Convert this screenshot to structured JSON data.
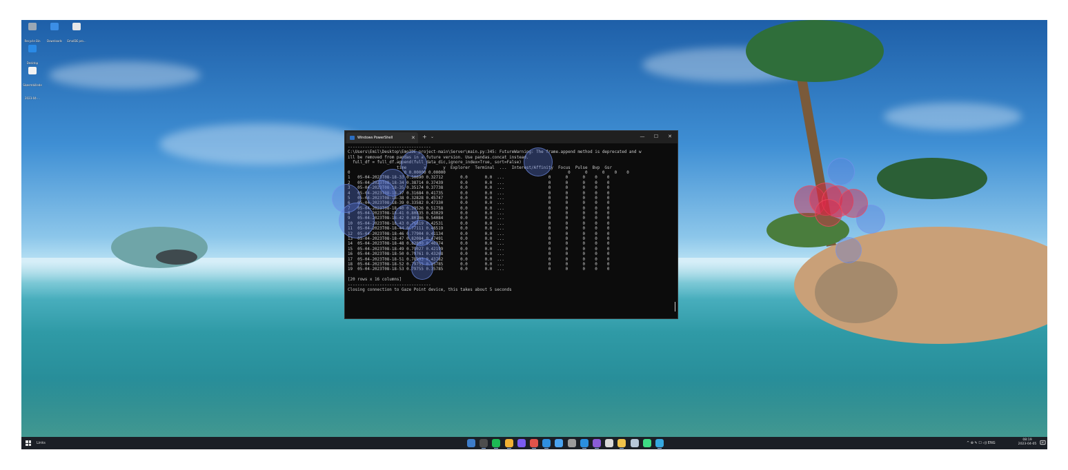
{
  "desktop": {
    "icons": [
      {
        "label": "Recycle Bin",
        "color": "#9aa7b5"
      },
      {
        "label": "Downloads",
        "color": "#3c8ee6"
      },
      {
        "label": "EmoIDE pro...",
        "color": "#e8e8e8"
      },
      {
        "label": "Desktop",
        "color": "#2a8ae6"
      },
      {
        "label": "Skærmbillede 2023-04-...",
        "color": "#f2f2f2"
      }
    ]
  },
  "terminal": {
    "tab_title": "Windows PowerShell",
    "tab_icon": "powershell-icon",
    "tab_close_glyph": "✕",
    "new_tab_glyph": "+",
    "menu_glyph": "⌄",
    "minimize_glyph": "—",
    "maximize_glyph": "☐",
    "close_glyph": "✕",
    "lines": [
      "----------------------------------",
      "C:\\Users\\Emil\\Desktop\\EmoIDE_project-main\\Server\\main.py:345: FutureWarning: The frame.append method is deprecated and w",
      "ill be removed from pandas in a future version. Use pandas.concat instead.",
      "  full_df = full_df.append(full_data_dic,ignore_index=True, sort=False)",
      "                    time       x       y  Explorer  Terminal  ...  Interest/Affinity  Focus  Pulse  Bvp  Gsr",
      "0                      0 0.00000 0.00000                                                  0      0      0    0    0",
      "1   05-04-2023T08-18-33 0.50690 0.32712       0.0       0.0  ...                  0      0      0    0    0",
      "2   05-04-2023T08-18-34 0.38714 0.37439       0.0       0.0  ...                  0      0      0    0    0",
      "3   05-04-2023T08-18-35 0.35174 0.37738       0.0       0.0  ...                  0      0      0    0    0",
      "4   05-04-2023T08-18-37 0.31684 0.41735       0.0       0.0  ...                  0      0      0    0    0",
      "5   05-04-2023T08-18-38 0.32828 0.45747       0.0       0.0  ...                  0      0      0    0    0",
      "6   05-04-2023T08-18-39 0.33582 0.47330       0.0       0.0  ...                  0      0      0    0    0",
      "7   05-04-2023T08-18-40 0.39526 0.51758       0.0       0.0  ...                  0      0      0    0    0",
      "8   05-04-2023T08-18-41 0.80835 0.43029       0.0       0.0  ...                  0      0      0    0    0",
      "9   05-04-2023T08-18-42 0.80186 0.54084       0.0       0.0  ...                  0      0      0    0    0",
      "10  05-04-2023T08-18-43 0.76819 0.42531       0.0       0.0  ...                  0      0      0    0    0",
      "11  05-04-2023T08-18-44 0.77111 0.46519       0.0       0.0  ...                  0      0      0    0    0",
      "12  05-04-2023T08-18-46 0.77904 0.41134       0.0       0.0  ...                  0      0      0    0    0",
      "13  05-04-2023T08-18-47 0.82084 0.47491       0.0       0.0  ...                  0      0      0    0    0",
      "14  05-04-2023T08-18-48 0.82890 0.46374       0.0       0.0  ...                  0      0      0    0    0",
      "15  05-04-2023T08-18-49 0.79027 0.42199       0.0       0.0  ...                  0      0      0    0    0",
      "16  05-04-2023T08-18-50 0.79761 0.43268       0.0       0.0  ...                  0      0      0    0    0",
      "17  05-04-2023T08-18-51 0.78993 0.43782       0.0       0.0  ...                  0      0      0    0    0",
      "18  05-04-2023T08-18-52 0.79755 0.35785       0.0       0.0  ...                  0      0      0    0    0",
      "19  05-04-2023T08-18-53 0.79755 0.35785       0.0       0.0  ...                  0      0      0    0    0",
      "",
      "[20 rows x 16 columns]",
      "----------------------------------",
      "Closing connection to Gaze Point device, this takes about 5 seconds"
    ]
  },
  "taskbar": {
    "start_icon": "windows-start-icon",
    "links_label": "Links",
    "apps": [
      {
        "name": "python-icon",
        "color": "#3d7cc9",
        "active": false
      },
      {
        "name": "terminal-icon",
        "color": "#4d4d4d",
        "active": true
      },
      {
        "name": "spotify-icon",
        "color": "#1db954",
        "active": true
      },
      {
        "name": "chrome-icon",
        "color": "#f2b134",
        "active": true
      },
      {
        "name": "feather-icon",
        "color": "#7a5cf0",
        "active": false
      },
      {
        "name": "chrome-profile-icon",
        "color": "#e0534a",
        "active": true
      },
      {
        "name": "edge-icon",
        "color": "#2f8fe0",
        "active": true
      },
      {
        "name": "checkmark-app-icon",
        "color": "#4aa3f0",
        "active": false
      },
      {
        "name": "unity-icon",
        "color": "#9b9b9b",
        "active": false
      },
      {
        "name": "vscode-icon",
        "color": "#2a8fdf",
        "active": true
      },
      {
        "name": "visual-studio-icon",
        "color": "#8a5cd6",
        "active": true
      },
      {
        "name": "settings-gear-icon",
        "color": "#d8d8d8",
        "active": false
      },
      {
        "name": "file-explorer-icon",
        "color": "#f0c24a",
        "active": true
      },
      {
        "name": "folder-app-icon",
        "color": "#b7c7d8",
        "active": false
      },
      {
        "name": "android-studio-icon",
        "color": "#3ddc84",
        "active": false
      },
      {
        "name": "globe-app-icon",
        "color": "#35a8e0",
        "active": true
      }
    ],
    "tray_text": "^  ⊕  ✎  ☐  ◁)  ENG",
    "time": "08:19",
    "date": "2023-04-05",
    "notification_icon": "notification-icon"
  }
}
